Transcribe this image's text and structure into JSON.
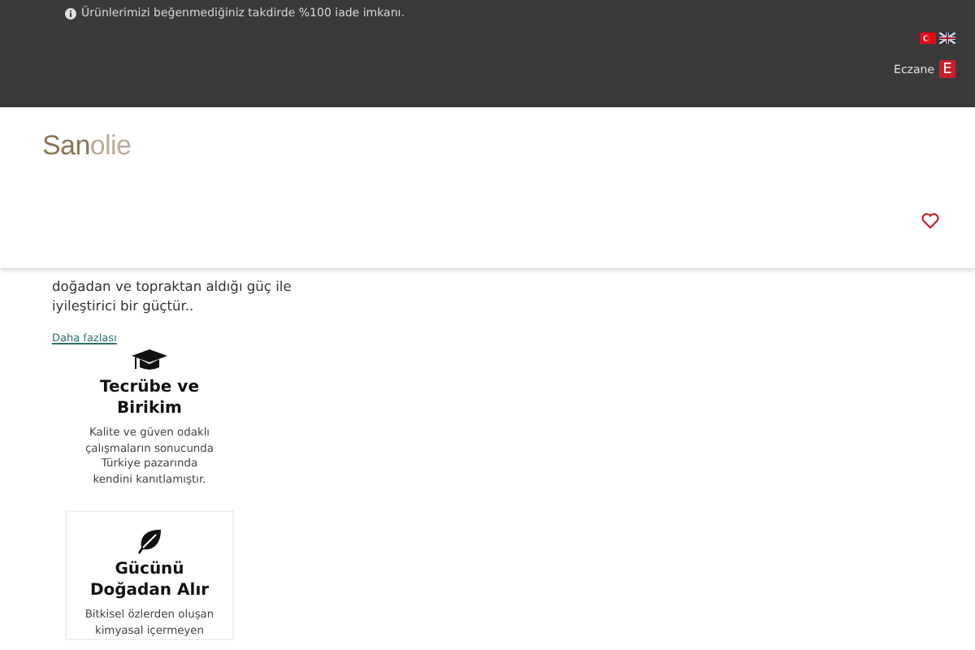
{
  "top_bar": {
    "notice": "Ürünlerimizi beğenmediğiniz takdirde %100 iade imkanı.",
    "languages": [
      {
        "kind": "turkish",
        "selected": true
      },
      {
        "kind": "british",
        "selected": false
      }
    ],
    "pharmacy": {
      "label": "Eczane",
      "badge": "E"
    }
  },
  "header": {
    "logo": {
      "strong": "San",
      "light": "olie"
    }
  },
  "intro": {
    "lines": [
      "doğadan ve topraktan aldığı güç ile",
      "iyileştirici bir güçtür.."
    ],
    "link": "Daha fazlası"
  },
  "features": [
    {
      "kind": "experience",
      "title": "Tecrübe ve Birikim",
      "text": "Kalite ve güven odaklı çalışmaların sonucunda Türkiye pazarında kendini kanıtlamıştır.",
      "bordered": false
    },
    {
      "kind": "nature",
      "title": "Gücünü Doğadan Alır",
      "text": "Bitkisel özlerden oluşan kimyasal içermeyen",
      "bordered": true
    }
  ]
}
